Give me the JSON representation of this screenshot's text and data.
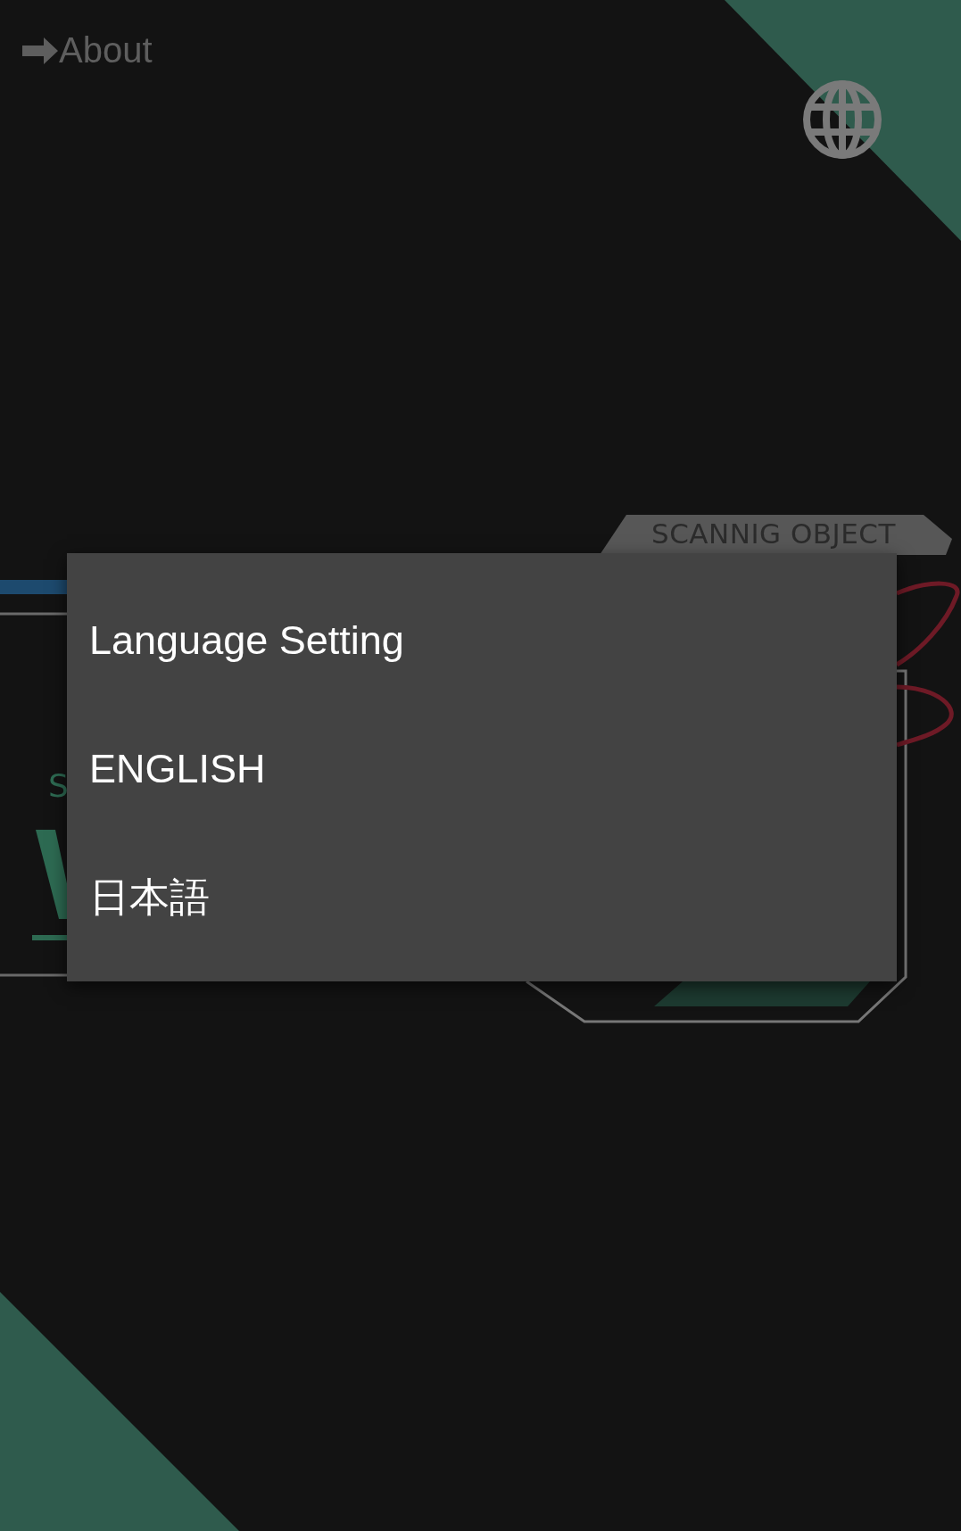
{
  "top_bar": {
    "about_link": "About"
  },
  "background_panel": {
    "tab_label": "SCANNIG OBJECT",
    "fragments": [
      {
        "text": "S",
        "kind": "caption"
      }
    ]
  },
  "dialog": {
    "title": "Language Setting",
    "options": [
      {
        "label": "ENGLISH"
      },
      {
        "label": "日本語"
      }
    ]
  }
}
